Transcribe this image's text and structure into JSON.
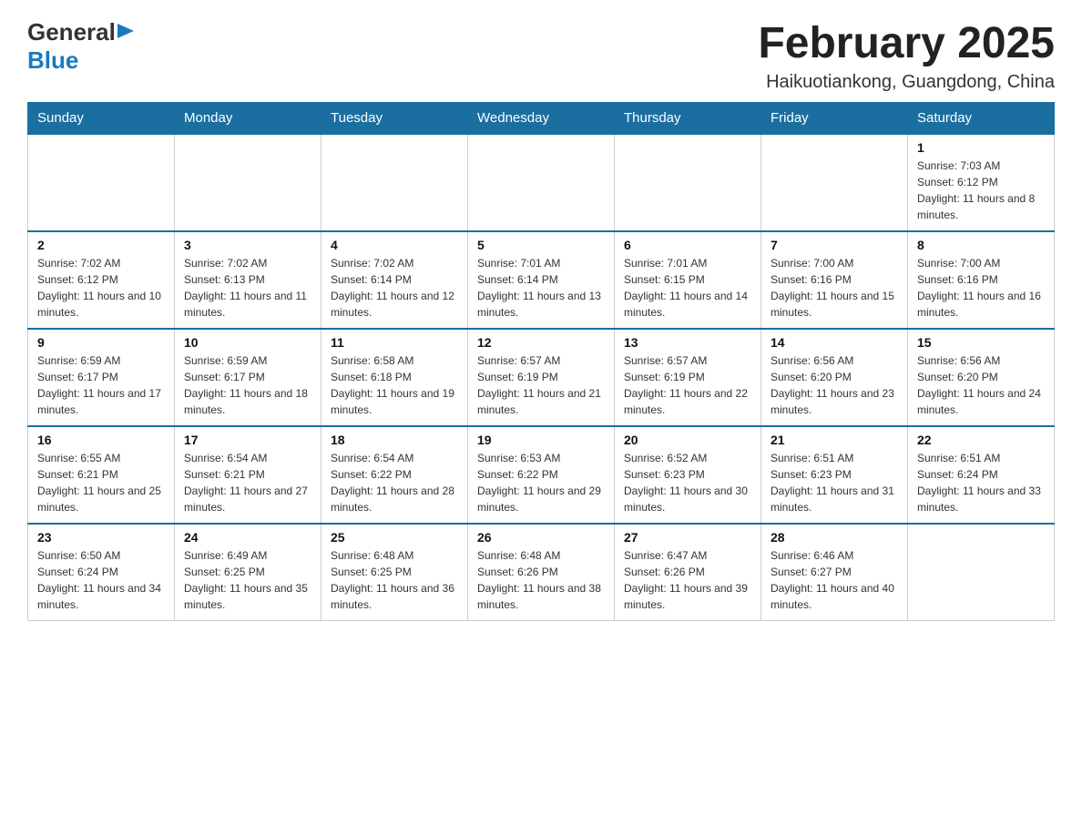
{
  "header": {
    "logo_general": "General",
    "logo_blue": "Blue",
    "main_title": "February 2025",
    "subtitle": "Haikuotiankong, Guangdong, China"
  },
  "days_of_week": [
    "Sunday",
    "Monday",
    "Tuesday",
    "Wednesday",
    "Thursday",
    "Friday",
    "Saturday"
  ],
  "weeks": [
    [
      {
        "day": "",
        "info": ""
      },
      {
        "day": "",
        "info": ""
      },
      {
        "day": "",
        "info": ""
      },
      {
        "day": "",
        "info": ""
      },
      {
        "day": "",
        "info": ""
      },
      {
        "day": "",
        "info": ""
      },
      {
        "day": "1",
        "info": "Sunrise: 7:03 AM\nSunset: 6:12 PM\nDaylight: 11 hours and 8 minutes."
      }
    ],
    [
      {
        "day": "2",
        "info": "Sunrise: 7:02 AM\nSunset: 6:12 PM\nDaylight: 11 hours and 10 minutes."
      },
      {
        "day": "3",
        "info": "Sunrise: 7:02 AM\nSunset: 6:13 PM\nDaylight: 11 hours and 11 minutes."
      },
      {
        "day": "4",
        "info": "Sunrise: 7:02 AM\nSunset: 6:14 PM\nDaylight: 11 hours and 12 minutes."
      },
      {
        "day": "5",
        "info": "Sunrise: 7:01 AM\nSunset: 6:14 PM\nDaylight: 11 hours and 13 minutes."
      },
      {
        "day": "6",
        "info": "Sunrise: 7:01 AM\nSunset: 6:15 PM\nDaylight: 11 hours and 14 minutes."
      },
      {
        "day": "7",
        "info": "Sunrise: 7:00 AM\nSunset: 6:16 PM\nDaylight: 11 hours and 15 minutes."
      },
      {
        "day": "8",
        "info": "Sunrise: 7:00 AM\nSunset: 6:16 PM\nDaylight: 11 hours and 16 minutes."
      }
    ],
    [
      {
        "day": "9",
        "info": "Sunrise: 6:59 AM\nSunset: 6:17 PM\nDaylight: 11 hours and 17 minutes."
      },
      {
        "day": "10",
        "info": "Sunrise: 6:59 AM\nSunset: 6:17 PM\nDaylight: 11 hours and 18 minutes."
      },
      {
        "day": "11",
        "info": "Sunrise: 6:58 AM\nSunset: 6:18 PM\nDaylight: 11 hours and 19 minutes."
      },
      {
        "day": "12",
        "info": "Sunrise: 6:57 AM\nSunset: 6:19 PM\nDaylight: 11 hours and 21 minutes."
      },
      {
        "day": "13",
        "info": "Sunrise: 6:57 AM\nSunset: 6:19 PM\nDaylight: 11 hours and 22 minutes."
      },
      {
        "day": "14",
        "info": "Sunrise: 6:56 AM\nSunset: 6:20 PM\nDaylight: 11 hours and 23 minutes."
      },
      {
        "day": "15",
        "info": "Sunrise: 6:56 AM\nSunset: 6:20 PM\nDaylight: 11 hours and 24 minutes."
      }
    ],
    [
      {
        "day": "16",
        "info": "Sunrise: 6:55 AM\nSunset: 6:21 PM\nDaylight: 11 hours and 25 minutes."
      },
      {
        "day": "17",
        "info": "Sunrise: 6:54 AM\nSunset: 6:21 PM\nDaylight: 11 hours and 27 minutes."
      },
      {
        "day": "18",
        "info": "Sunrise: 6:54 AM\nSunset: 6:22 PM\nDaylight: 11 hours and 28 minutes."
      },
      {
        "day": "19",
        "info": "Sunrise: 6:53 AM\nSunset: 6:22 PM\nDaylight: 11 hours and 29 minutes."
      },
      {
        "day": "20",
        "info": "Sunrise: 6:52 AM\nSunset: 6:23 PM\nDaylight: 11 hours and 30 minutes."
      },
      {
        "day": "21",
        "info": "Sunrise: 6:51 AM\nSunset: 6:23 PM\nDaylight: 11 hours and 31 minutes."
      },
      {
        "day": "22",
        "info": "Sunrise: 6:51 AM\nSunset: 6:24 PM\nDaylight: 11 hours and 33 minutes."
      }
    ],
    [
      {
        "day": "23",
        "info": "Sunrise: 6:50 AM\nSunset: 6:24 PM\nDaylight: 11 hours and 34 minutes."
      },
      {
        "day": "24",
        "info": "Sunrise: 6:49 AM\nSunset: 6:25 PM\nDaylight: 11 hours and 35 minutes."
      },
      {
        "day": "25",
        "info": "Sunrise: 6:48 AM\nSunset: 6:25 PM\nDaylight: 11 hours and 36 minutes."
      },
      {
        "day": "26",
        "info": "Sunrise: 6:48 AM\nSunset: 6:26 PM\nDaylight: 11 hours and 38 minutes."
      },
      {
        "day": "27",
        "info": "Sunrise: 6:47 AM\nSunset: 6:26 PM\nDaylight: 11 hours and 39 minutes."
      },
      {
        "day": "28",
        "info": "Sunrise: 6:46 AM\nSunset: 6:27 PM\nDaylight: 11 hours and 40 minutes."
      },
      {
        "day": "",
        "info": ""
      }
    ]
  ]
}
